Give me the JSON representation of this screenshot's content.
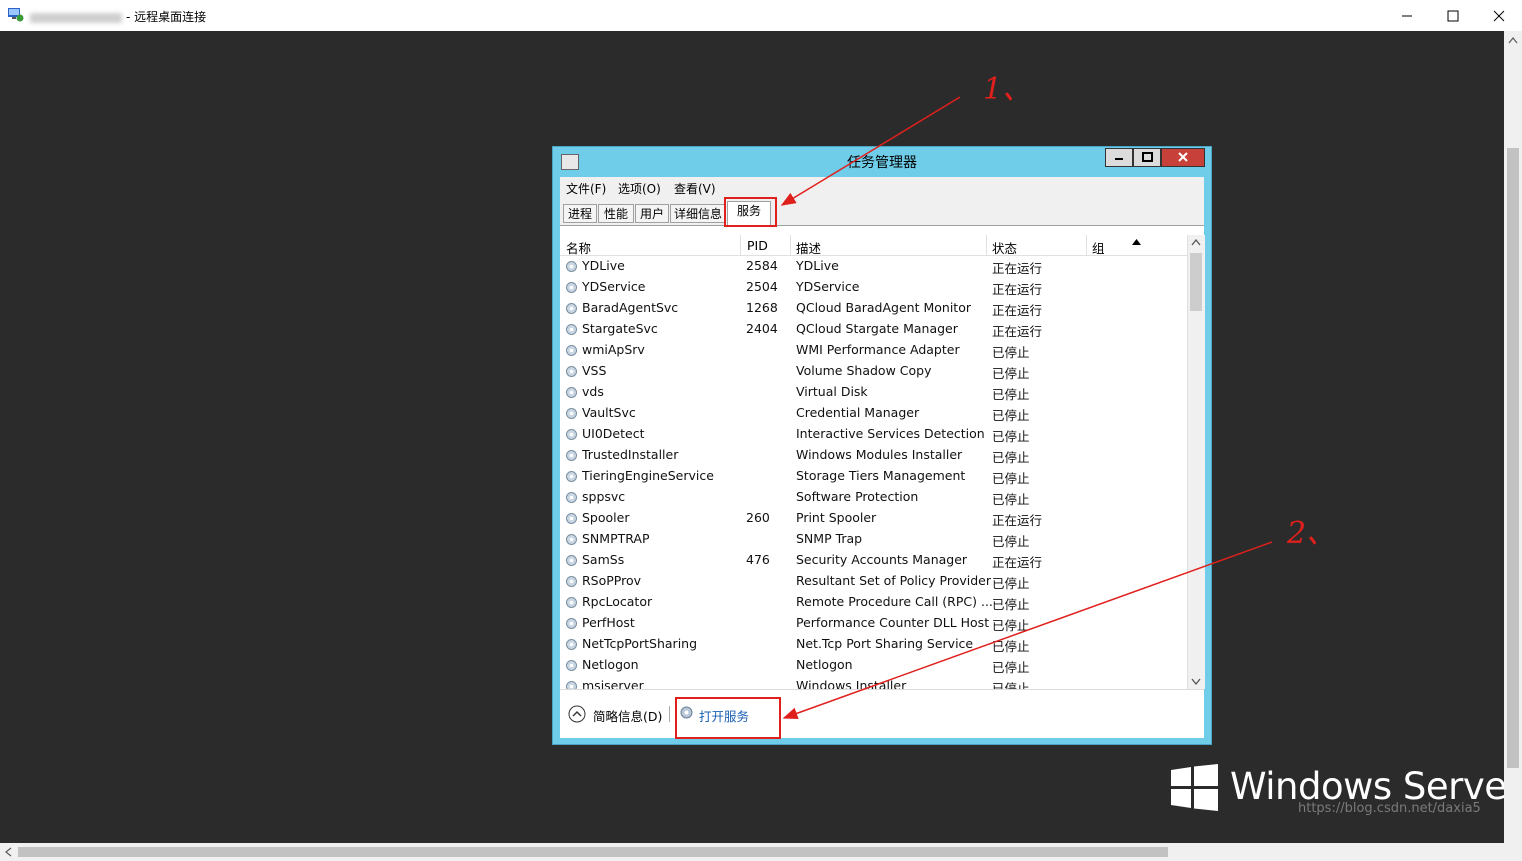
{
  "rdp": {
    "title": "- 远程桌面连接"
  },
  "task_manager": {
    "title": "任务管理器",
    "menu": [
      "文件(F)",
      "选项(O)",
      "查看(V)"
    ],
    "tabs": [
      "进程",
      "性能",
      "用户",
      "详细信息",
      "服务"
    ],
    "active_tab": "服务",
    "columns": [
      "名称",
      "PID",
      "描述",
      "状态",
      "组"
    ],
    "rows": [
      {
        "name": "YDLive",
        "pid": "2584",
        "desc": "YDLive",
        "status": "正在运行"
      },
      {
        "name": "YDService",
        "pid": "2504",
        "desc": "YDService",
        "status": "正在运行"
      },
      {
        "name": "BaradAgentSvc",
        "pid": "1268",
        "desc": "QCloud BaradAgent Monitor",
        "status": "正在运行"
      },
      {
        "name": "StargateSvc",
        "pid": "2404",
        "desc": "QCloud Stargate Manager",
        "status": "正在运行"
      },
      {
        "name": "wmiApSrv",
        "pid": "",
        "desc": "WMI Performance Adapter",
        "status": "已停止"
      },
      {
        "name": "VSS",
        "pid": "",
        "desc": "Volume Shadow Copy",
        "status": "已停止"
      },
      {
        "name": "vds",
        "pid": "",
        "desc": "Virtual Disk",
        "status": "已停止"
      },
      {
        "name": "VaultSvc",
        "pid": "",
        "desc": "Credential Manager",
        "status": "已停止"
      },
      {
        "name": "UI0Detect",
        "pid": "",
        "desc": "Interactive Services Detection",
        "status": "已停止"
      },
      {
        "name": "TrustedInstaller",
        "pid": "",
        "desc": "Windows Modules Installer",
        "status": "已停止"
      },
      {
        "name": "TieringEngineService",
        "pid": "",
        "desc": "Storage Tiers Management",
        "status": "已停止"
      },
      {
        "name": "sppsvc",
        "pid": "",
        "desc": "Software Protection",
        "status": "已停止"
      },
      {
        "name": "Spooler",
        "pid": "260",
        "desc": "Print Spooler",
        "status": "正在运行"
      },
      {
        "name": "SNMPTRAP",
        "pid": "",
        "desc": "SNMP Trap",
        "status": "已停止"
      },
      {
        "name": "SamSs",
        "pid": "476",
        "desc": "Security Accounts Manager",
        "status": "正在运行"
      },
      {
        "name": "RSoPProv",
        "pid": "",
        "desc": "Resultant Set of Policy Provider",
        "status": "已停止"
      },
      {
        "name": "RpcLocator",
        "pid": "",
        "desc": "Remote Procedure Call (RPC) ...",
        "status": "已停止"
      },
      {
        "name": "PerfHost",
        "pid": "",
        "desc": "Performance Counter DLL Host",
        "status": "已停止"
      },
      {
        "name": "NetTcpPortSharing",
        "pid": "",
        "desc": "Net.Tcp Port Sharing Service",
        "status": "已停止"
      },
      {
        "name": "Netlogon",
        "pid": "",
        "desc": "Netlogon",
        "status": "已停止"
      },
      {
        "name": "msiserver",
        "pid": "",
        "desc": "Windows Installer",
        "status": "已停止"
      }
    ],
    "brief_info": "简略信息(D)",
    "open_services": "打开服务"
  },
  "branding": {
    "windows_server": "Windows Server",
    "watermark": "https://blog.csdn.net/daxia5"
  },
  "annotations": {
    "one": "1、",
    "two": "2、",
    "color": "#e0201c"
  }
}
